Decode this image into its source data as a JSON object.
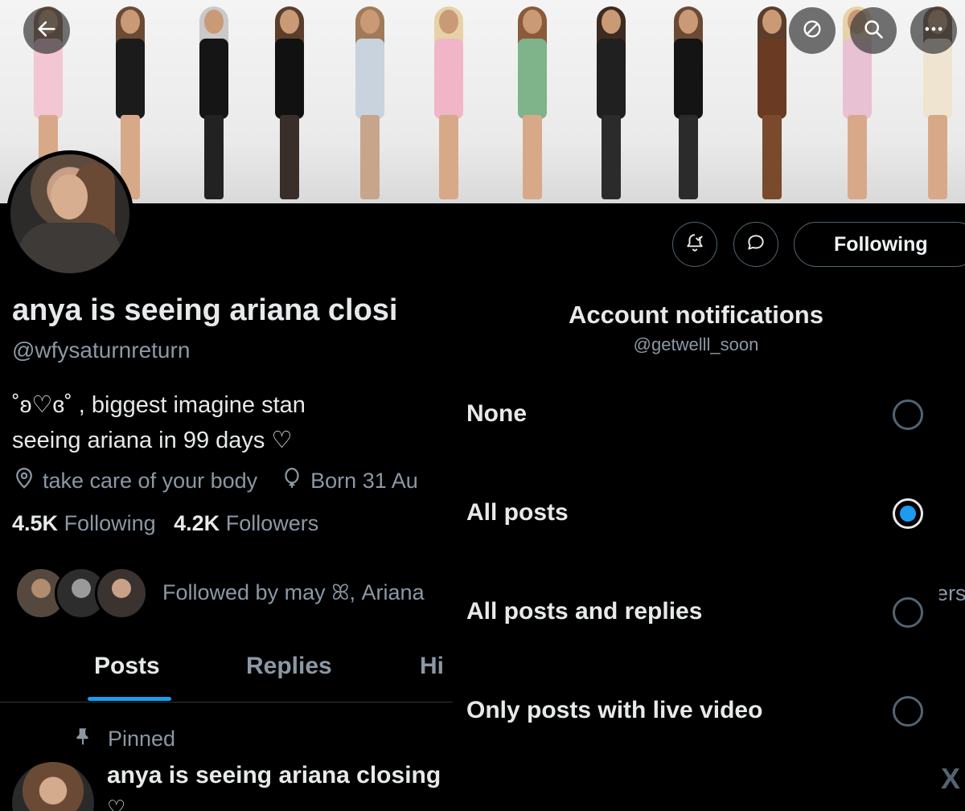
{
  "header": {
    "back_icon": "back-arrow-icon",
    "actions": [
      "restricted-icon",
      "search-icon",
      "more-icon"
    ]
  },
  "profile": {
    "display_name": "anya is seeing ariana closi",
    "handle": "@wfysaturnreturn",
    "bio_line1": "˚ʚ♡ɞ˚ , biggest imagine stan",
    "bio_line2": "seeing ariana in 99 days ♡",
    "location": "take care of your body",
    "birthday": "Born 31 Au",
    "following_count": "4.5K",
    "following_label": "Following",
    "followers_count": "4.2K",
    "followers_label": "Followers",
    "followed_by": "Followed by may ꕤ, Ariana",
    "follow_button": "Following"
  },
  "tabs": [
    {
      "label": "Posts",
      "active": true
    },
    {
      "label": "Replies",
      "active": false
    },
    {
      "label": "Hi",
      "active": false
    }
  ],
  "pinned_post": {
    "pinned_label": "Pinned",
    "text": "anya is seeing ariana closing",
    "extra": "♡"
  },
  "notifications_sheet": {
    "title": "Account notifications",
    "subtitle": "@getwelll_soon",
    "options": [
      {
        "label": "None",
        "selected": false
      },
      {
        "label": "All posts",
        "selected": true
      },
      {
        "label": "All posts and replies",
        "selected": false
      },
      {
        "label": "Only posts with live video",
        "selected": false
      }
    ]
  },
  "right_strip_text": "ers",
  "watermark": "X",
  "colors": {
    "accent": "#1d9bf0",
    "text_primary": "#e7e9ea",
    "text_secondary": "#8b98a5",
    "border": "#536471",
    "background": "#000000"
  }
}
